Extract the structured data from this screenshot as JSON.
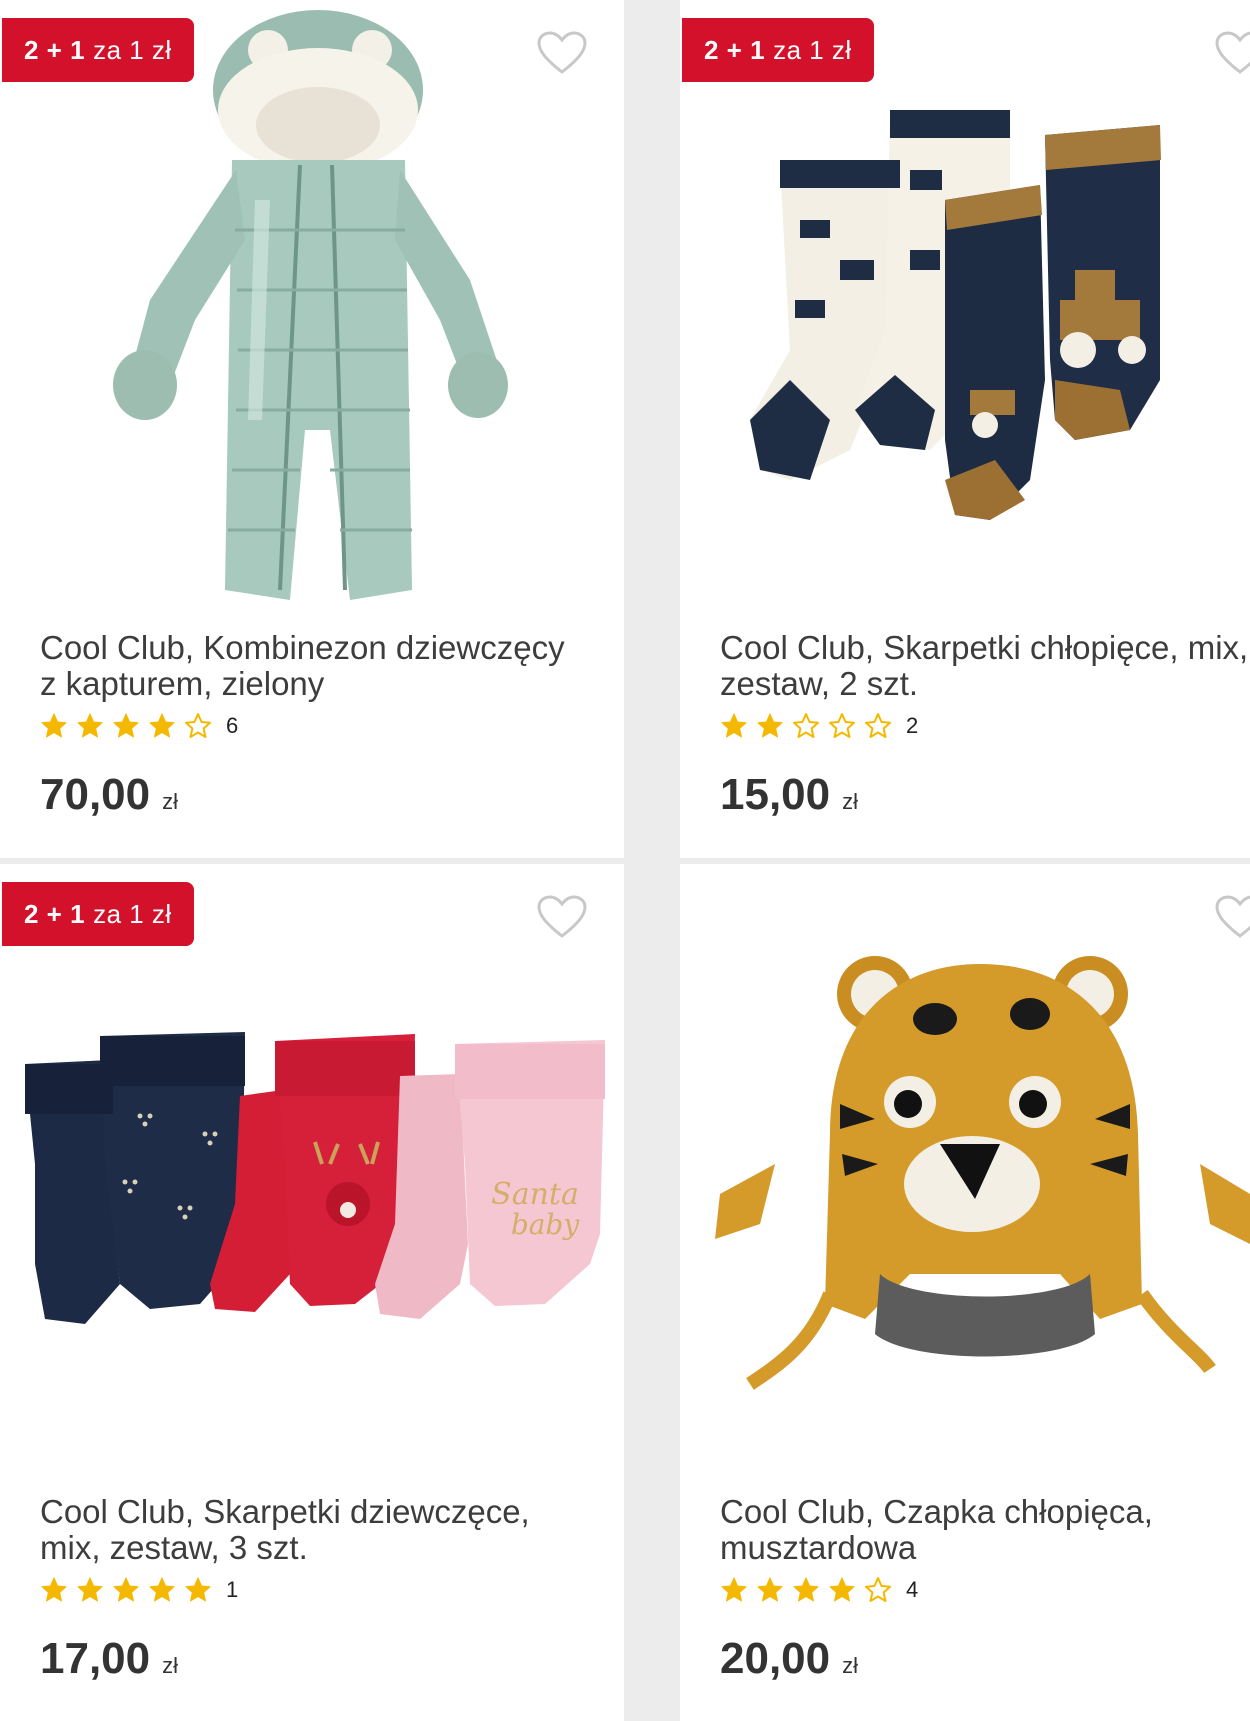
{
  "products": [
    {
      "badge": {
        "strong": "2 + 1",
        "rest": "za 1 zł"
      },
      "title": "Cool Club, Kombinezon dziewczęcy\nz kapturem, zielony",
      "rating": 4,
      "rating_count": "6",
      "price": "70,00",
      "currency": "zł",
      "image": "snowsuit-image"
    },
    {
      "badge": {
        "strong": "2 + 1",
        "rest": "za 1 zł"
      },
      "title": "Cool Club, Skarpetki chłopięce, mix,\nzestaw, 2 szt.",
      "rating": 2,
      "rating_count": "2",
      "price": "15,00",
      "currency": "zł",
      "image": "tractor-socks-image"
    },
    {
      "badge": {
        "strong": "2 + 1",
        "rest": "za 1 zł"
      },
      "title": "Cool Club, Skarpetki dziewczęce,\nmix, zestaw, 3 szt.",
      "rating": 5,
      "rating_count": "1",
      "price": "17,00",
      "currency": "zł",
      "image": "girls-socks-image"
    },
    {
      "badge": null,
      "title": "Cool Club, Czapka chłopięca,\nmusztardowa",
      "rating": 4,
      "rating_count": "4",
      "price": "20,00",
      "currency": "zł",
      "image": "tiger-hat-image"
    }
  ],
  "colors": {
    "badge": "#d3112b",
    "star": "#f5b800",
    "text": "#3d3d3d",
    "heart": "#c8c8c8"
  },
  "icons": {
    "favorite": "heart-outline-icon",
    "rating": "star-icon"
  }
}
